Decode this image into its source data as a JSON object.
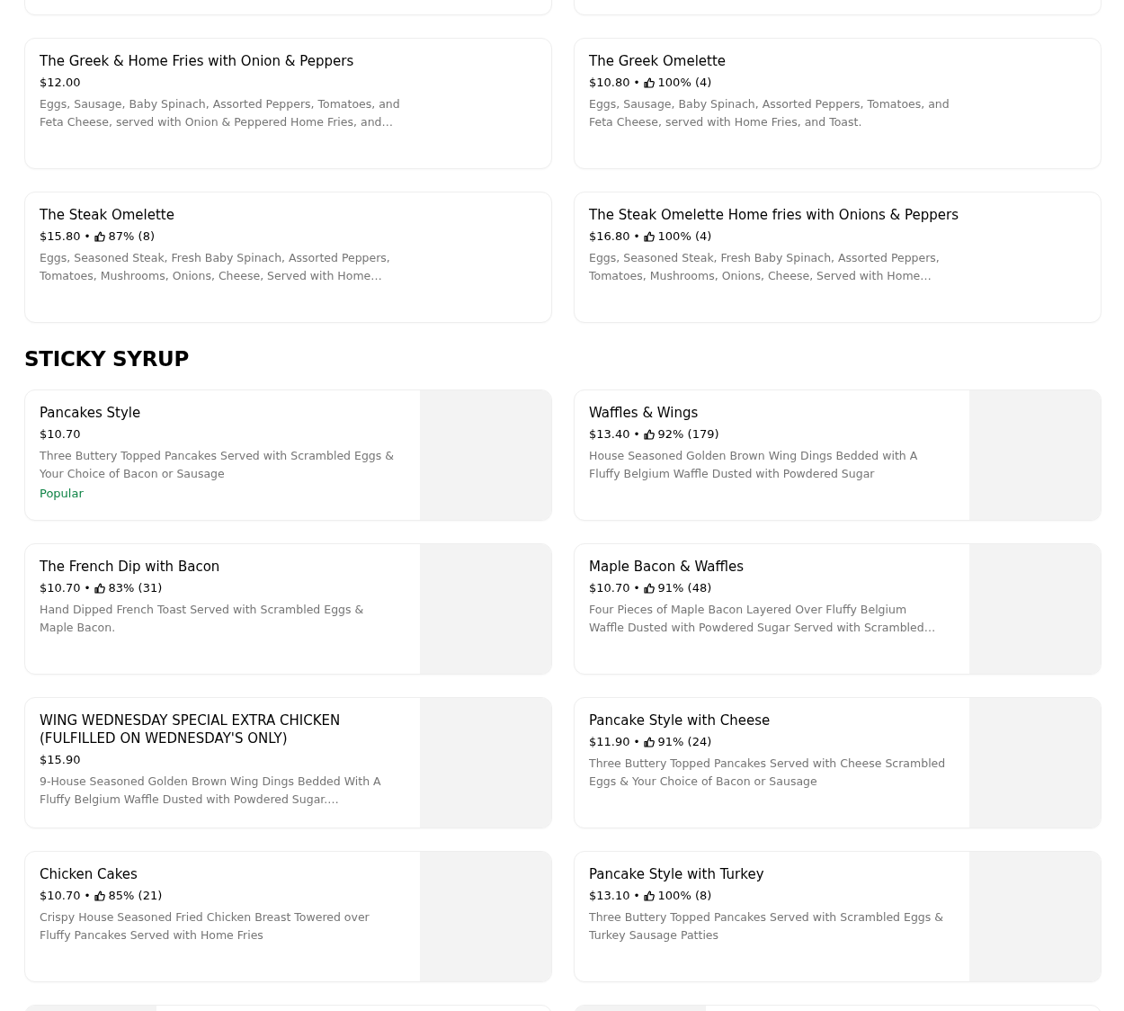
{
  "sections": [
    {
      "items": [
        {
          "name": "The Greek & Home Fries with Onion & Peppers",
          "price": "$12.00",
          "description": [
            "Eggs, Sausage, Baby Spinach, Assorted Peppers, Tomatoes, and",
            "Feta Cheese, served with Onion & Peppered Home Fries, and…"
          ],
          "has_image": false
        },
        {
          "name": "The Greek Omelette",
          "price": "$10.80",
          "separator": "•",
          "rating": "100% (4)",
          "description": [
            "Eggs, Sausage, Baby Spinach, Assorted Peppers, Tomatoes, and",
            "Feta Cheese, served with Home Fries, and Toast."
          ],
          "has_image": false
        },
        {
          "name": "The Steak Omelette",
          "price": "$15.80",
          "separator": "•",
          "rating": "87% (8)",
          "description": [
            "Eggs, Seasoned Steak, Fresh Baby Spinach, Assorted Peppers,",
            "Tomatoes, Mushrooms, Onions, Cheese, Served with Home…"
          ],
          "has_image": false
        },
        {
          "name": "The Steak Omelette Home fries with Onions & Peppers",
          "price": "$16.80",
          "separator": "•",
          "rating": "100% (4)",
          "description": [
            "Eggs, Seasoned Steak, Fresh Baby Spinach, Assorted Peppers,",
            "Tomatoes, Mushrooms, Onions, Cheese, Served with Home…"
          ],
          "has_image": false
        }
      ]
    },
    {
      "heading": "STICKY SYRUP",
      "items": [
        {
          "name": "Pancakes Style",
          "price": "$10.70",
          "description": [
            "Three Buttery Topped Pancakes Served with Scrambled Eggs &",
            "Your Choice of Bacon or Sausage"
          ],
          "badge": "Popular",
          "has_image": true
        },
        {
          "name": "Waffles & Wings",
          "price": "$13.40",
          "separator": "•",
          "rating": "92% (179)",
          "description": [
            "House Seasoned Golden Brown Wing Dings Bedded with A",
            "Fluffy Belgium Waffle Dusted with Powdered Sugar"
          ],
          "has_image": true
        },
        {
          "name": "The French Dip with Bacon",
          "price": "$10.70",
          "separator": "•",
          "rating": "83% (31)",
          "description": [
            "Hand Dipped French Toast Served with Scrambled Eggs &",
            "Maple Bacon."
          ],
          "has_image": true
        },
        {
          "name": "Maple Bacon & Waffles",
          "price": "$10.70",
          "separator": "•",
          "rating": "91% (48)",
          "description": [
            "Four Pieces of Maple Bacon Layered Over Fluffy Belgium",
            "Waffle Dusted with Powdered Sugar Served with Scrambled…"
          ],
          "has_image": true
        },
        {
          "name": "WING WEDNESDAY SPECIAL EXTRA CHICKEN (FULFILLED ON WEDNESDAY'S ONLY)",
          "price": "$15.90",
          "description": [
            "9-House Seasoned Golden Brown Wing Dings Bedded With A",
            "Fluffy Belgium Waffle Dusted with Powdered Sugar.…"
          ],
          "has_image": true
        },
        {
          "name": "Pancake Style with Cheese",
          "price": "$11.90",
          "separator": "•",
          "rating": "91% (24)",
          "description": [
            "Three Buttery Topped Pancakes Served with Cheese Scrambled",
            "Eggs & Your Choice of Bacon or Sausage"
          ],
          "has_image": true
        },
        {
          "name": "Chicken Cakes",
          "price": "$10.70",
          "separator": "•",
          "rating": "85% (21)",
          "description": [
            "Crispy House Seasoned Fried Chicken Breast Towered over",
            "Fluffy Pancakes Served with Home Fries"
          ],
          "has_image": true
        },
        {
          "name": "Pancake Style with Turkey",
          "price": "$13.10",
          "separator": "•",
          "rating": "100% (8)",
          "description": [
            "Three Buttery Topped Pancakes Served with Scrambled Eggs &",
            "Turkey Sausage Patties"
          ],
          "has_image": true
        }
      ]
    }
  ]
}
